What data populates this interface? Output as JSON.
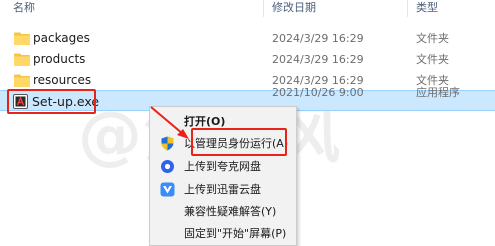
{
  "header": {
    "name_label": "名称",
    "date_label": "修改日期",
    "type_label": "类型"
  },
  "files": [
    {
      "name": "packages",
      "date": "2024/3/29 16:29",
      "type": "文件夹"
    },
    {
      "name": "products",
      "date": "2024/3/29 16:29",
      "type": "文件夹"
    },
    {
      "name": "resources",
      "date": "2024/3/29 16:29",
      "type": "文件夹"
    },
    {
      "name": "Set-up.exe",
      "date": "2021/10/26 9:00",
      "type": "应用程序"
    }
  ],
  "context_menu": {
    "items": [
      {
        "label": "打开(O)",
        "icon": "none"
      },
      {
        "label": "以管理员身份运行(A)",
        "icon": "uac-shield-icon"
      },
      {
        "label": "上传到夸克网盘",
        "icon": "quark-icon"
      },
      {
        "label": "上传到迅雷云盘",
        "icon": "xunlei-icon"
      },
      {
        "label": "兼容性疑难解答(Y)",
        "icon": "none"
      },
      {
        "label": "固定到\"开始\"屏幕(P)",
        "icon": "none"
      }
    ]
  },
  "watermark": "@河子风",
  "colors": {
    "selection": "#cce8ff",
    "highlight_red": "#e8231a",
    "folder_yellow": "#f5c542"
  }
}
